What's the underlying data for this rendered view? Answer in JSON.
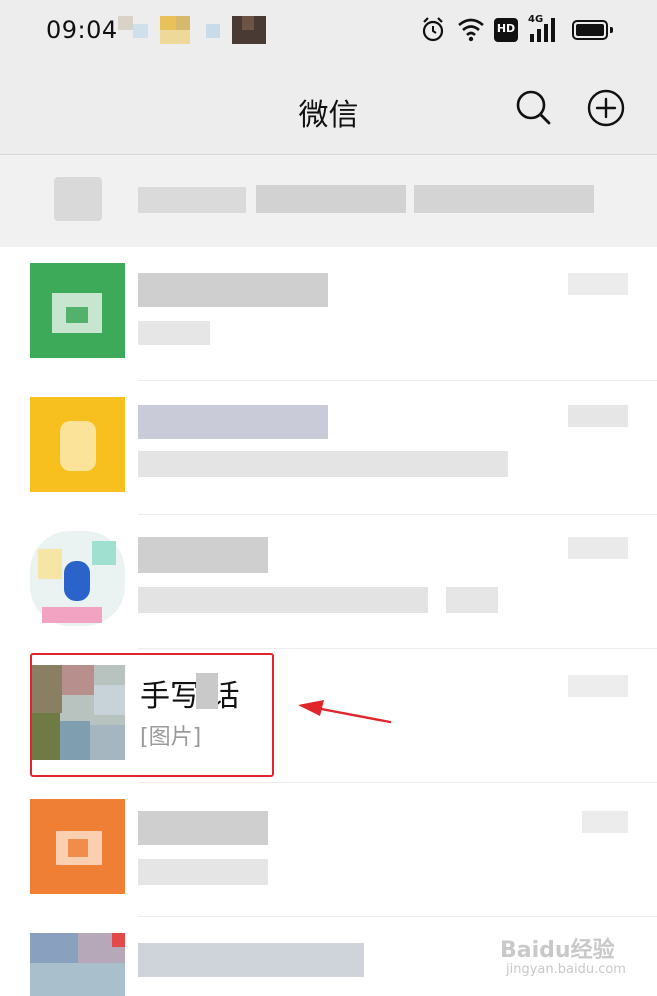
{
  "status_bar": {
    "time": "09:04",
    "icons": [
      "alarm-icon",
      "wifi-icon",
      "hd-icon",
      "signal-4g-icon",
      "battery-icon"
    ],
    "hd_label": "HD",
    "network_label": "4G"
  },
  "navbar": {
    "title": "微信",
    "search_icon": "search-icon",
    "add_icon": "add-circle-icon"
  },
  "highlighted_chat": {
    "name": "手写 话",
    "preview": "[图片]"
  },
  "annotation": {
    "arrow_color": "#e0262b",
    "box_color": "#e0262b"
  },
  "watermark": {
    "brand": "Baidu经验",
    "url": "jingyan.baidu.com"
  },
  "colors": {
    "nav_bg": "#ededed",
    "list_bg": "#ffffff"
  }
}
